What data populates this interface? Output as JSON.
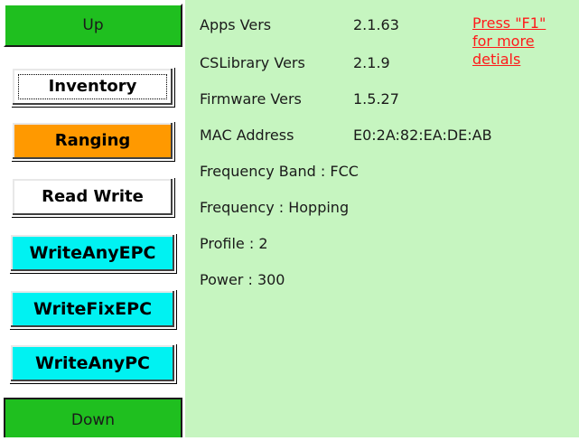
{
  "nav": {
    "up_label": "Up",
    "down_label": "Down"
  },
  "menu": {
    "inventory": "Inventory",
    "ranging": "Ranging",
    "read_write": "Read Write",
    "write_any_epc": "WriteAnyEPC",
    "write_fix_epc": "WriteFixEPC",
    "write_any_pc": "WriteAnyPC"
  },
  "info": {
    "apps_label": "Apps Vers",
    "apps_value": "2.1.63",
    "cslib_label": "CSLibrary Vers",
    "cslib_value": "2.1.9",
    "firmware_label": "Firmware Vers",
    "firmware_value": "1.5.27",
    "mac_label": "MAC Address",
    "mac_value": "E0:2A:82:EA:DE:AB",
    "freq_band": "Frequency Band : FCC",
    "frequency": "Frequency : Hopping",
    "profile": "Profile : 2",
    "power": "Power : 300"
  },
  "help": {
    "line1": "Press \"F1\"",
    "line2": "for more",
    "line3": "detials"
  },
  "colors": {
    "nav_green": "#1fbf1f",
    "content_bg": "#c6f5c0",
    "orange": "#ff9900",
    "cyan": "#00f2f2",
    "help_red": "#ff1a1a"
  }
}
